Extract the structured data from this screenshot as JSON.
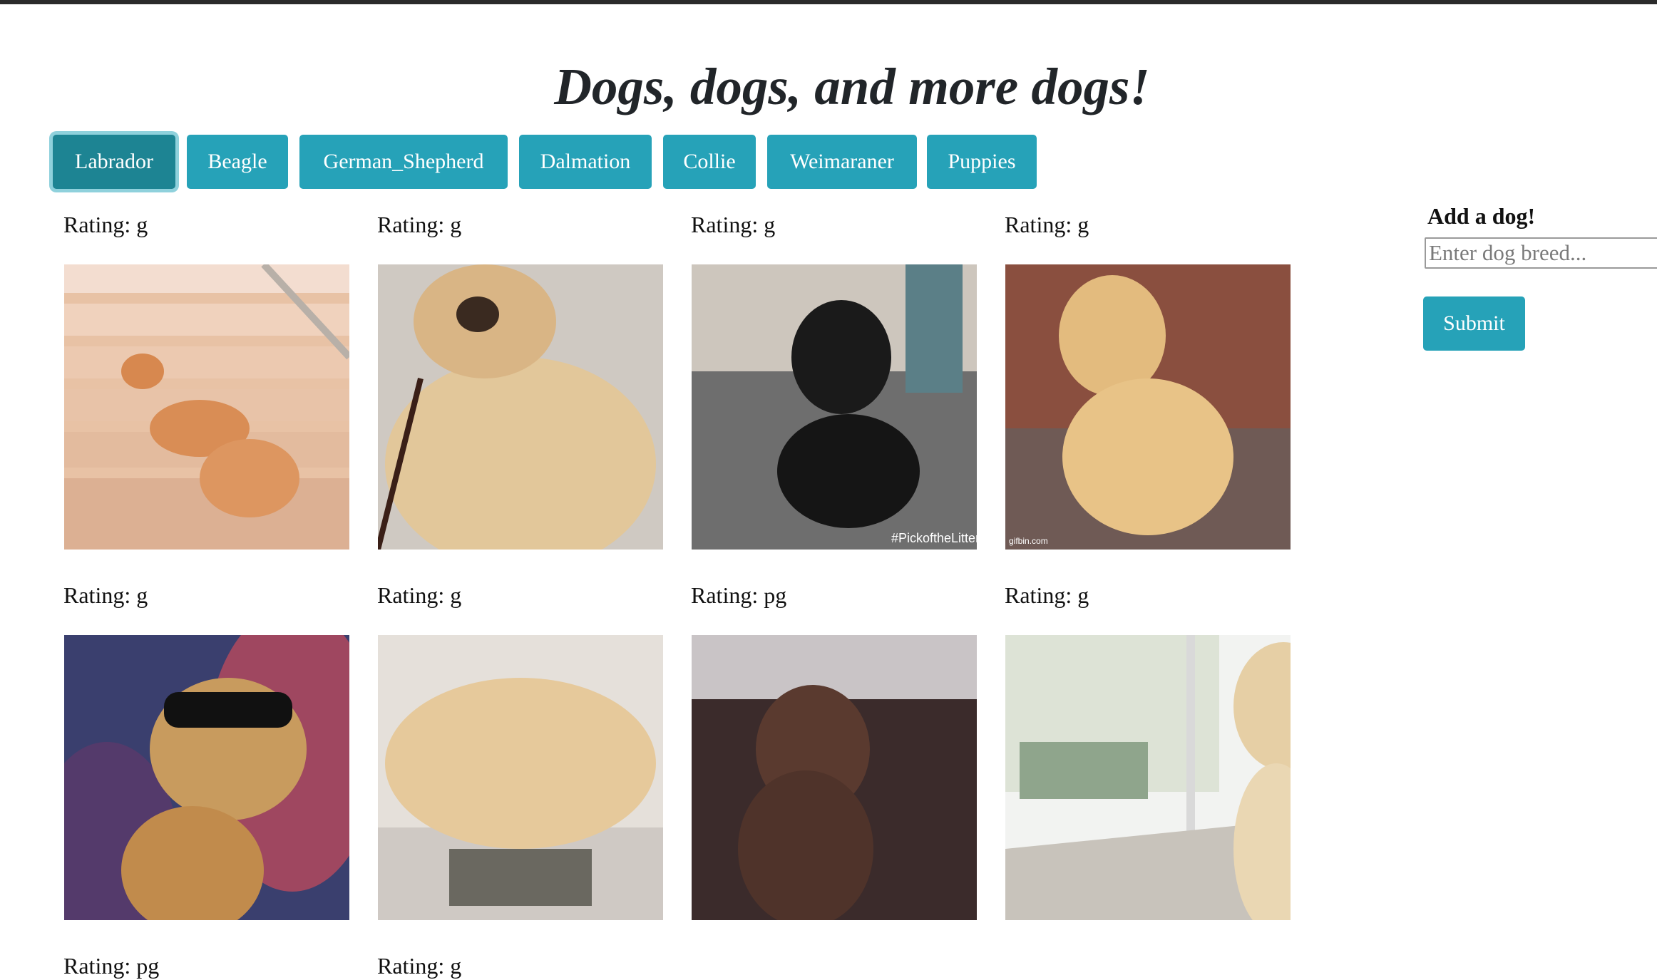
{
  "title": "Dogs, dogs, and more dogs!",
  "breeds": [
    {
      "label": "Labrador",
      "active": true
    },
    {
      "label": "Beagle",
      "active": false
    },
    {
      "label": "German_Shepherd",
      "active": false
    },
    {
      "label": "Dalmation",
      "active": false
    },
    {
      "label": "Collie",
      "active": false
    },
    {
      "label": "Weimaraner",
      "active": false
    },
    {
      "label": "Puppies",
      "active": false
    }
  ],
  "gifs": [
    {
      "rating": "Rating: g",
      "image": "labrador-puppy-sliding-down-stairs"
    },
    {
      "rating": "Rating: g",
      "image": "yellow-labrador-puppy-sitting-closeup"
    },
    {
      "rating": "Rating: g",
      "image": "black-labrador-puppy-lying-on-floor",
      "watermark": "#PickoftheLitter"
    },
    {
      "rating": "Rating: g",
      "image": "golden-retriever-sitting-on-deck",
      "watermark": "gifbin.com"
    },
    {
      "rating": "Rating: g",
      "image": "labrador-with-sunglasses-in-space"
    },
    {
      "rating": "Rating: g",
      "image": "yellow-labrador-puppy-sleeping-on-vent"
    },
    {
      "rating": "Rating: pg",
      "image": "chocolate-labrador-puppy-on-mat"
    },
    {
      "rating": "Rating: g",
      "image": "golden-puppy-at-window"
    },
    {
      "rating": "Rating: pg",
      "image": null
    },
    {
      "rating": "Rating: g",
      "image": null
    }
  ],
  "add_form": {
    "label": "Add a dog!",
    "placeholder": "Enter dog breed...",
    "submit_label": "Submit"
  }
}
